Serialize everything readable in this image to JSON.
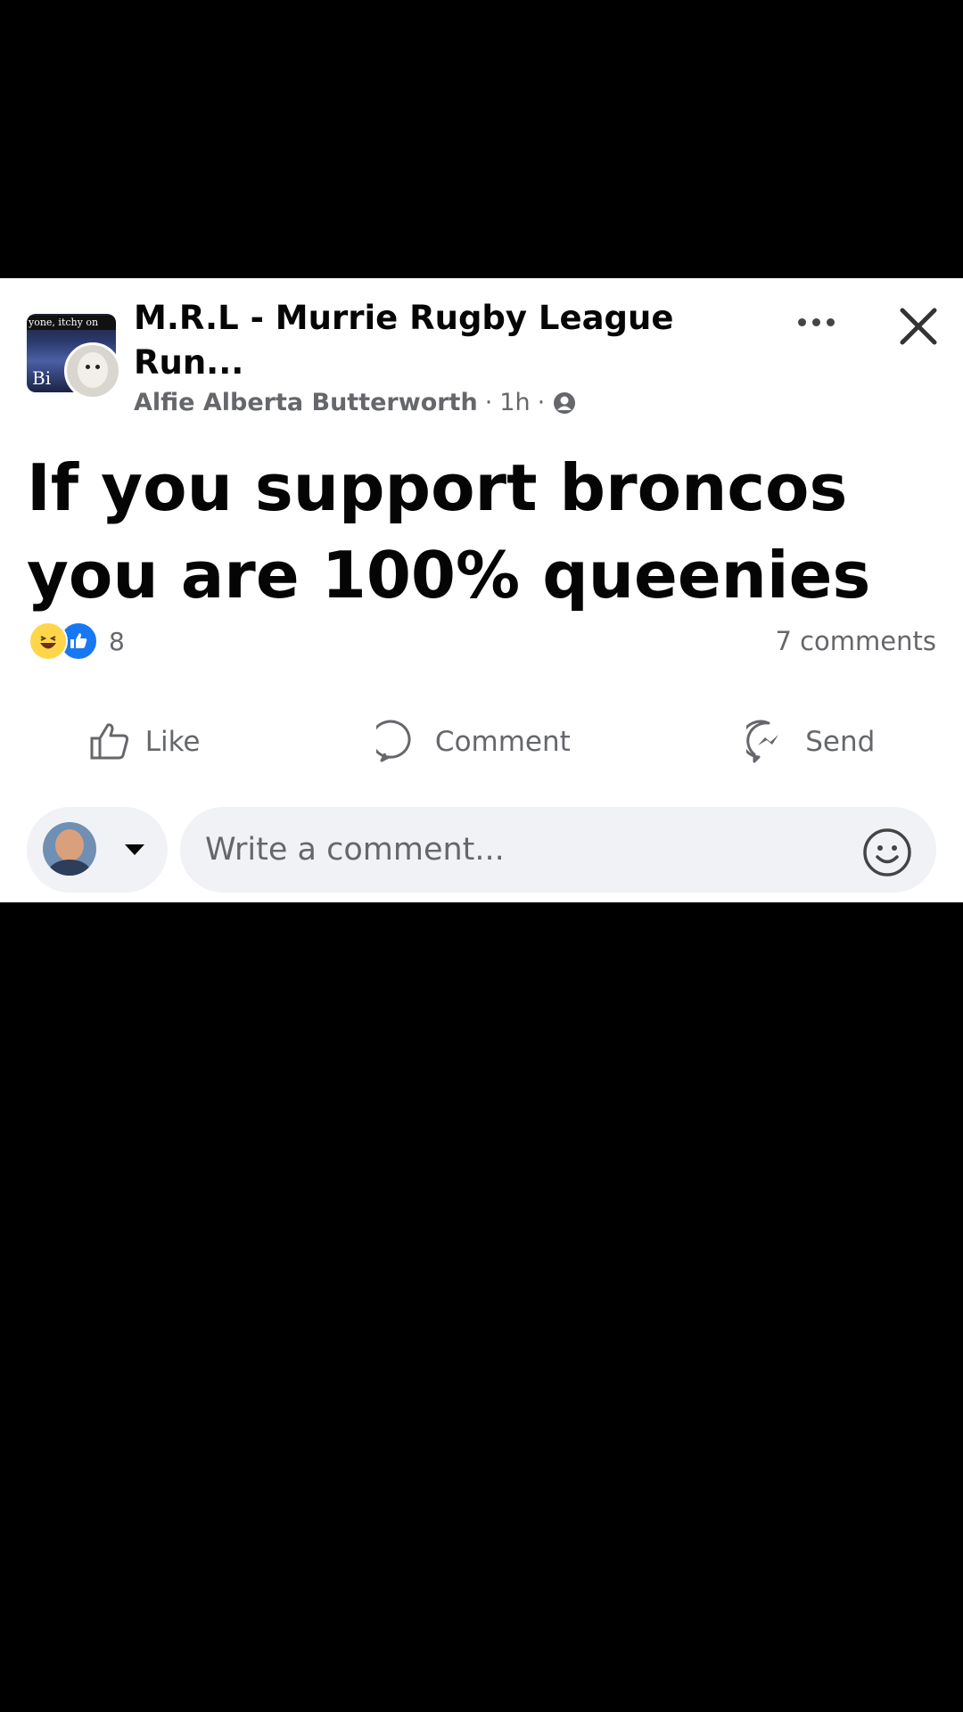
{
  "post": {
    "group_name": "M.R.L - Murrie Rugby League Run...",
    "group_thumb_caption": "yone, itchy on",
    "group_thumb_text": "Bi",
    "author": "Alfie Alberta Butterworth",
    "separator": "·",
    "time": "1h",
    "audience_icon": "globe-icon",
    "text": "If you support broncos you are 100% queenies",
    "reaction_count": "8",
    "reactions": [
      "haha",
      "like"
    ],
    "comment_count": "7 comments"
  },
  "actions": {
    "like_label": "Like",
    "comment_label": "Comment",
    "send_label": "Send"
  },
  "composer": {
    "placeholder": "Write a comment..."
  },
  "colors": {
    "background": "#000000",
    "card": "#ffffff",
    "text_primary": "#050505",
    "text_secondary": "#65676b",
    "like_blue": "#1877f2",
    "input_bg": "#f0f2f5"
  }
}
